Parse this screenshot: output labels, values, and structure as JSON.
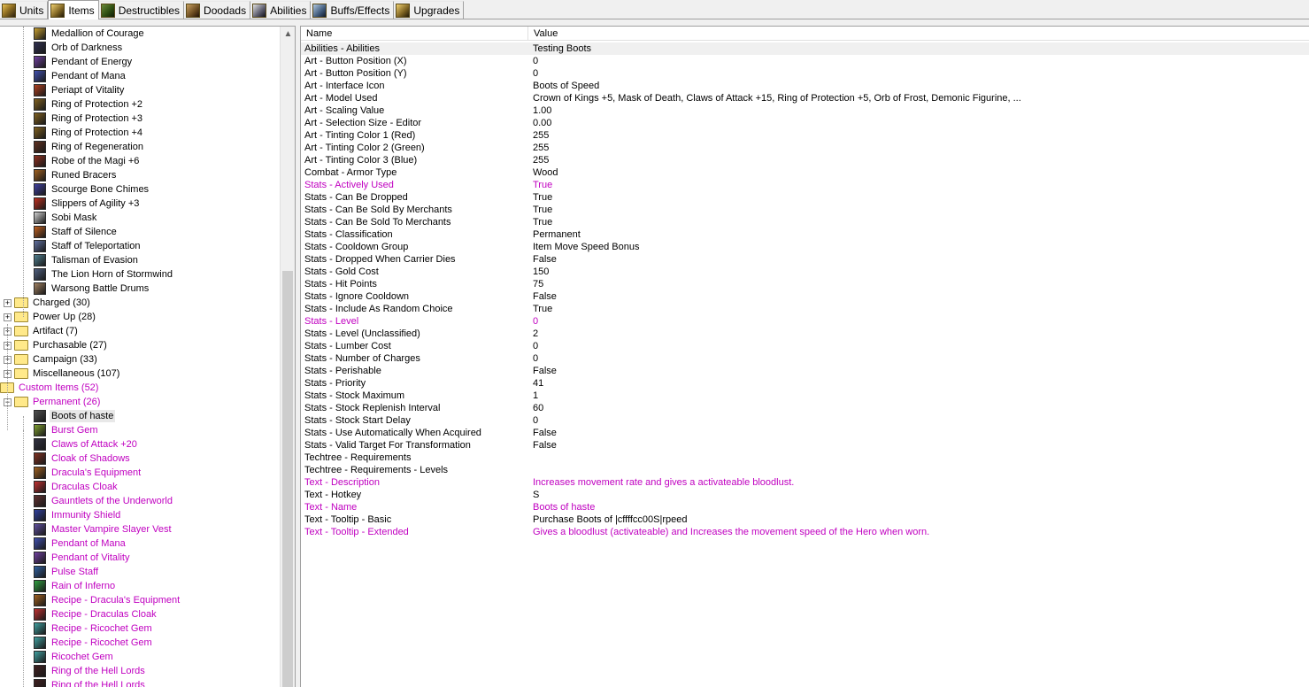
{
  "tabs": [
    {
      "label": "Units",
      "icon": "units-icon",
      "cls": ""
    },
    {
      "label": "Items",
      "icon": "items-icon",
      "cls": "c5"
    },
    {
      "label": "Destructibles",
      "icon": "destructibles-icon",
      "cls": "c1"
    },
    {
      "label": "Doodads",
      "icon": "doodads-icon",
      "cls": "c2"
    },
    {
      "label": "Abilities",
      "icon": "abilities-icon",
      "cls": "c4"
    },
    {
      "label": "Buffs/Effects",
      "icon": "buffs-effects-icon",
      "cls": "c3"
    },
    {
      "label": "Upgrades",
      "icon": "upgrades-icon",
      "cls": "c5"
    }
  ],
  "active_tab": 1,
  "tree": [
    {
      "type": "item",
      "level": 2,
      "label": "Medallion of Courage",
      "color": "#c8a030"
    },
    {
      "type": "item",
      "level": 2,
      "label": "Orb of Darkness",
      "color": "#303050"
    },
    {
      "type": "item",
      "level": 2,
      "label": "Pendant of Energy",
      "color": "#7040a0"
    },
    {
      "type": "item",
      "level": 2,
      "label": "Pendant of Mana",
      "color": "#4050b0"
    },
    {
      "type": "item",
      "level": 2,
      "label": "Periapt of Vitality",
      "color": "#b04020"
    },
    {
      "type": "item",
      "level": 2,
      "label": "Ring of Protection +2",
      "color": "#806020"
    },
    {
      "type": "item",
      "level": 2,
      "label": "Ring of Protection +3",
      "color": "#806020"
    },
    {
      "type": "item",
      "level": 2,
      "label": "Ring of Protection +4",
      "color": "#806020"
    },
    {
      "type": "item",
      "level": 2,
      "label": "Ring of Regeneration",
      "color": "#603020"
    },
    {
      "type": "item",
      "level": 2,
      "label": "Robe of the Magi +6",
      "color": "#903020"
    },
    {
      "type": "item",
      "level": 2,
      "label": "Runed Bracers",
      "color": "#a06020"
    },
    {
      "type": "item",
      "level": 2,
      "label": "Scourge Bone Chimes",
      "color": "#4040a0"
    },
    {
      "type": "item",
      "level": 2,
      "label": "Slippers of Agility +3",
      "color": "#c03020"
    },
    {
      "type": "item",
      "level": 2,
      "label": "Sobi Mask",
      "color": "#d0d0d0"
    },
    {
      "type": "item",
      "level": 2,
      "label": "Staff of Silence",
      "color": "#c06020"
    },
    {
      "type": "item",
      "level": 2,
      "label": "Staff of Teleportation",
      "color": "#6070a0"
    },
    {
      "type": "item",
      "level": 2,
      "label": "Talisman of Evasion",
      "color": "#508090"
    },
    {
      "type": "item",
      "level": 2,
      "label": "The Lion Horn of Stormwind",
      "color": "#506080"
    },
    {
      "type": "item",
      "level": 2,
      "label": "Warsong Battle Drums",
      "color": "#a08060"
    },
    {
      "type": "folder",
      "level": 1,
      "label": "Charged (30)"
    },
    {
      "type": "folder",
      "level": 1,
      "label": "Power Up (28)"
    },
    {
      "type": "folder",
      "level": 1,
      "label": "Artifact (7)"
    },
    {
      "type": "folder",
      "level": 1,
      "label": "Purchasable (27)"
    },
    {
      "type": "folder",
      "level": 1,
      "label": "Campaign (33)"
    },
    {
      "type": "folder",
      "level": 1,
      "label": "Miscellaneous (107)"
    },
    {
      "type": "folder-open",
      "level": 0,
      "label": "Custom Items (52)",
      "custom": true
    },
    {
      "type": "folder-open",
      "level": 1,
      "label": "Permanent (26)",
      "custom": true
    },
    {
      "type": "item",
      "level": 2,
      "label": "Boots of haste",
      "color": "#505050",
      "selected": true
    },
    {
      "type": "item",
      "level": 2,
      "label": "Burst Gem",
      "color": "#80a030",
      "custom": true
    },
    {
      "type": "item",
      "level": 2,
      "label": "Claws of Attack +20",
      "color": "#303040",
      "custom": true
    },
    {
      "type": "item",
      "level": 2,
      "label": "Cloak of Shadows",
      "color": "#803020",
      "custom": true
    },
    {
      "type": "item",
      "level": 2,
      "label": "Dracula's Equipment",
      "color": "#a06020",
      "custom": true
    },
    {
      "type": "item",
      "level": 2,
      "label": "Draculas Cloak",
      "color": "#c03030",
      "custom": true
    },
    {
      "type": "item",
      "level": 2,
      "label": "Gauntlets of the Underworld",
      "color": "#603030",
      "custom": true
    },
    {
      "type": "item",
      "level": 2,
      "label": "Immunity Shield",
      "color": "#3040a0",
      "custom": true
    },
    {
      "type": "item",
      "level": 2,
      "label": "Master Vampire Slayer Vest",
      "color": "#6050a0",
      "custom": true
    },
    {
      "type": "item",
      "level": 2,
      "label": "Pendant of Mana",
      "color": "#4050b0",
      "custom": true
    },
    {
      "type": "item",
      "level": 2,
      "label": "Pendant of Vitality",
      "color": "#7040a0",
      "custom": true
    },
    {
      "type": "item",
      "level": 2,
      "label": "Pulse Staff",
      "color": "#3060a0",
      "custom": true
    },
    {
      "type": "item",
      "level": 2,
      "label": "Rain of Inferno",
      "color": "#30a040",
      "custom": true
    },
    {
      "type": "item",
      "level": 2,
      "label": "Recipe - Dracula's Equipment",
      "color": "#a06020",
      "custom": true
    },
    {
      "type": "item",
      "level": 2,
      "label": "Recipe - Draculas Cloak",
      "color": "#c03030",
      "custom": true
    },
    {
      "type": "item",
      "level": 2,
      "label": "Recipe - Ricochet Gem",
      "color": "#40a0a0",
      "custom": true
    },
    {
      "type": "item",
      "level": 2,
      "label": "Recipe - Ricochet Gem",
      "color": "#40a0a0",
      "custom": true
    },
    {
      "type": "item",
      "level": 2,
      "label": "Ricochet Gem",
      "color": "#40a0a0",
      "custom": true
    },
    {
      "type": "item",
      "level": 2,
      "label": "Ring of the Hell Lords",
      "color": "#402020",
      "custom": true
    },
    {
      "type": "item",
      "level": 2,
      "label": "Ring of the Hell Lords",
      "color": "#402020",
      "custom": true
    }
  ],
  "grid": {
    "columns": [
      "Name",
      "Value"
    ],
    "rows": [
      {
        "name": "Abilities - Abilities",
        "value": "Testing Boots"
      },
      {
        "name": "Art - Button Position (X)",
        "value": "0"
      },
      {
        "name": "Art - Button Position (Y)",
        "value": "0"
      },
      {
        "name": "Art - Interface Icon",
        "value": "Boots of Speed"
      },
      {
        "name": "Art - Model Used",
        "value": "Crown of Kings +5, Mask of Death, Claws of Attack +15, Ring of Protection +5, Orb of Frost, Demonic Figurine, ..."
      },
      {
        "name": "Art - Scaling Value",
        "value": "1.00"
      },
      {
        "name": "Art - Selection Size - Editor",
        "value": "0.00"
      },
      {
        "name": "Art - Tinting Color 1 (Red)",
        "value": "255"
      },
      {
        "name": "Art - Tinting Color 2 (Green)",
        "value": "255"
      },
      {
        "name": "Art - Tinting Color 3 (Blue)",
        "value": "255"
      },
      {
        "name": "Combat - Armor Type",
        "value": "Wood"
      },
      {
        "name": "Stats - Actively Used",
        "value": "True",
        "custom": true
      },
      {
        "name": "Stats - Can Be Dropped",
        "value": "True"
      },
      {
        "name": "Stats - Can Be Sold By Merchants",
        "value": "True"
      },
      {
        "name": "Stats - Can Be Sold To Merchants",
        "value": "True"
      },
      {
        "name": "Stats - Classification",
        "value": "Permanent"
      },
      {
        "name": "Stats - Cooldown Group",
        "value": "Item Move Speed Bonus"
      },
      {
        "name": "Stats - Dropped When Carrier Dies",
        "value": "False"
      },
      {
        "name": "Stats - Gold Cost",
        "value": "150"
      },
      {
        "name": "Stats - Hit Points",
        "value": "75"
      },
      {
        "name": "Stats - Ignore Cooldown",
        "value": "False"
      },
      {
        "name": "Stats - Include As Random Choice",
        "value": "True"
      },
      {
        "name": "Stats - Level",
        "value": "0",
        "custom": true
      },
      {
        "name": "Stats - Level (Unclassified)",
        "value": "2"
      },
      {
        "name": "Stats - Lumber Cost",
        "value": "0"
      },
      {
        "name": "Stats - Number of Charges",
        "value": "0"
      },
      {
        "name": "Stats - Perishable",
        "value": "False"
      },
      {
        "name": "Stats - Priority",
        "value": "41"
      },
      {
        "name": "Stats - Stock Maximum",
        "value": "1"
      },
      {
        "name": "Stats - Stock Replenish Interval",
        "value": "60"
      },
      {
        "name": "Stats - Stock Start Delay",
        "value": "0"
      },
      {
        "name": "Stats - Use Automatically When Acquired",
        "value": "False"
      },
      {
        "name": "Stats - Valid Target For Transformation",
        "value": "False"
      },
      {
        "name": "Techtree - Requirements",
        "value": ""
      },
      {
        "name": "Techtree - Requirements - Levels",
        "value": ""
      },
      {
        "name": "Text - Description",
        "value": "Increases movement rate and gives a activateable bloodlust.",
        "custom": true
      },
      {
        "name": "Text - Hotkey",
        "value": "S"
      },
      {
        "name": "Text - Name",
        "value": "Boots of haste",
        "custom": true
      },
      {
        "name": "Text - Tooltip - Basic",
        "value": "Purchase Boots of |cffffcc00S|rpeed"
      },
      {
        "name": "Text - Tooltip - Extended",
        "value": "Gives a bloodlust (activateable) and Increases the movement speed of the Hero when worn.",
        "custom": true
      }
    ]
  }
}
